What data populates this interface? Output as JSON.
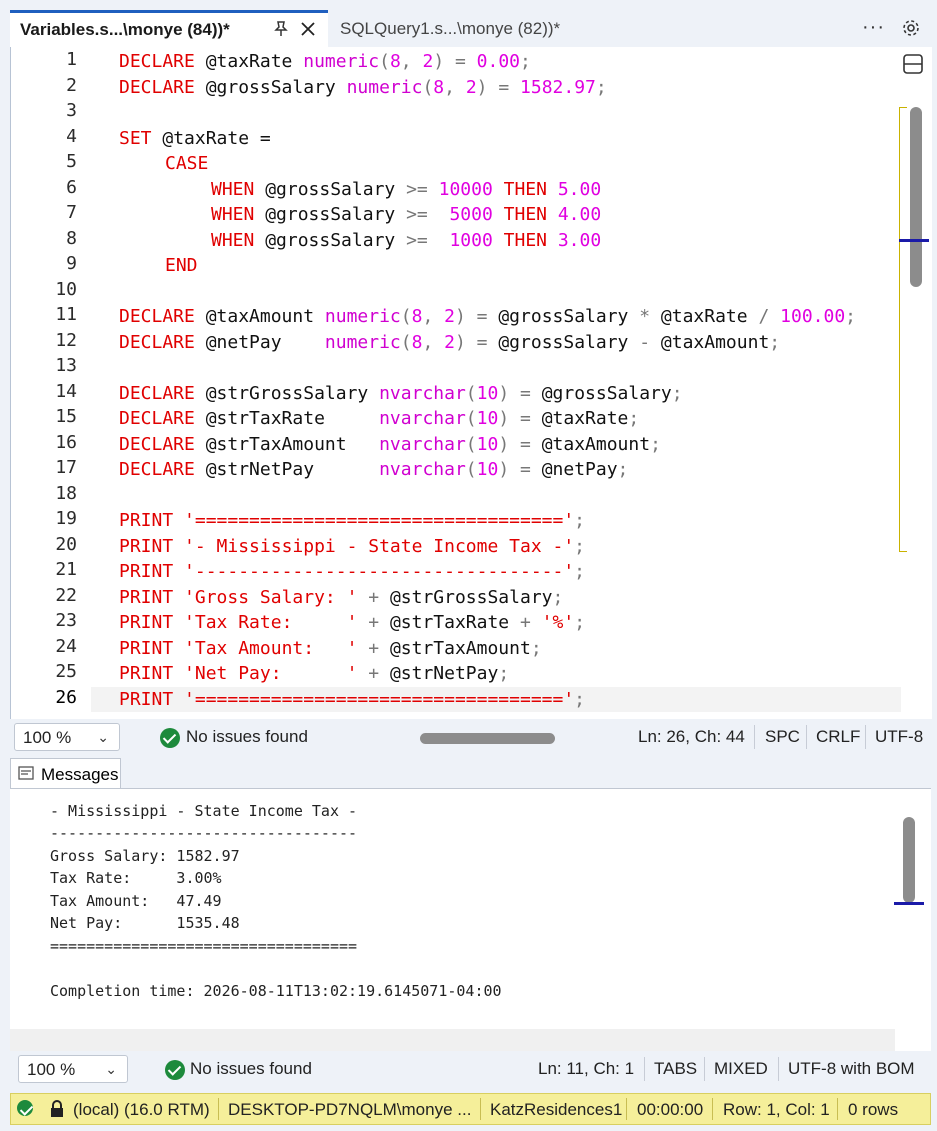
{
  "tabs": [
    {
      "label": "Variables.s...\\monye (84))*",
      "active": true
    },
    {
      "label": "SQLQuery1.s...\\monye (82))*",
      "active": false
    }
  ],
  "tab_actions": {
    "more": "···"
  },
  "editor": {
    "line_numbers": [
      "1",
      "2",
      "3",
      "4",
      "5",
      "6",
      "7",
      "8",
      "9",
      "10",
      "11",
      "12",
      "13",
      "14",
      "15",
      "16",
      "17",
      "18",
      "19",
      "20",
      "21",
      "22",
      "23",
      "24",
      "25",
      "26"
    ],
    "current_line": "26"
  },
  "code": {
    "l1": {
      "kw": "DECLARE",
      "var": " @taxRate ",
      "ty": "numeric",
      "p1": "(",
      "n1": "8",
      "c": ", ",
      "n2": "2",
      "p2": ")",
      "eq": " = ",
      "val": "0.00",
      "sc": ";"
    },
    "l2": {
      "kw": "DECLARE",
      "var": " @grossSalary ",
      "ty": "numeric",
      "p1": "(",
      "n1": "8",
      "c": ", ",
      "n2": "2",
      "p2": ")",
      "eq": " = ",
      "val": "1582.97",
      "sc": ";"
    },
    "l4": {
      "kw": "SET",
      "var": " @taxRate ="
    },
    "l5": {
      "kw": "CASE"
    },
    "l6": {
      "kw": "WHEN",
      "var": " @grossSalary ",
      "op": ">=",
      "pad": " ",
      "num": "10000",
      "then": " THEN ",
      "res": "5.00"
    },
    "l7": {
      "kw": "WHEN",
      "var": " @grossSalary ",
      "op": ">=",
      "pad": "  ",
      "num": "5000",
      "then": " THEN ",
      "res": "4.00"
    },
    "l8": {
      "kw": "WHEN",
      "var": " @grossSalary ",
      "op": ">=",
      "pad": "  ",
      "num": "1000",
      "then": " THEN ",
      "res": "3.00"
    },
    "l9": {
      "kw": "END"
    },
    "l11": {
      "kw": "DECLARE",
      "var": " @taxAmount ",
      "ty": "numeric",
      "p1": "(",
      "n1": "8",
      "c": ", ",
      "n2": "2",
      "p2": ")",
      "eq": " = ",
      "v1": "@grossSalary ",
      "op1": "*",
      "v2": " @taxRate ",
      "op2": "/",
      "sp": " ",
      "val": "100.00",
      "sc": ";"
    },
    "l12": {
      "kw": "DECLARE",
      "var": " @netPay    ",
      "ty": "numeric",
      "p1": "(",
      "n1": "8",
      "c": ", ",
      "n2": "2",
      "p2": ")",
      "eq": " = ",
      "v1": "@grossSalary ",
      "op1": "-",
      "v2": " @taxAmount",
      "sc": ";"
    },
    "l14": {
      "kw": "DECLARE",
      "var": " @strGrossSalary ",
      "ty": "nvarchar",
      "p1": "(",
      "n1": "10",
      "p2": ")",
      "eq": " = ",
      "val": "@grossSalary",
      "sc": ";"
    },
    "l15": {
      "kw": "DECLARE",
      "var": " @strTaxRate     ",
      "ty": "nvarchar",
      "p1": "(",
      "n1": "10",
      "p2": ")",
      "eq": " = ",
      "val": "@taxRate",
      "sc": ";"
    },
    "l16": {
      "kw": "DECLARE",
      "var": " @strTaxAmount   ",
      "ty": "nvarchar",
      "p1": "(",
      "n1": "10",
      "p2": ")",
      "eq": " = ",
      "val": "@taxAmount",
      "sc": ";"
    },
    "l17": {
      "kw": "DECLARE",
      "var": " @strNetPay      ",
      "ty": "nvarchar",
      "p1": "(",
      "n1": "10",
      "p2": ")",
      "eq": " = ",
      "val": "@netPay",
      "sc": ";"
    },
    "l19": {
      "kw": "PRINT",
      "sp": " ",
      "str": "'=================================='",
      "sc": ";"
    },
    "l20": {
      "kw": "PRINT",
      "sp": " ",
      "str": "'- Mississippi - State Income Tax -'",
      "sc": ";"
    },
    "l21": {
      "kw": "PRINT",
      "sp": " ",
      "str": "'----------------------------------'",
      "sc": ";"
    },
    "l22": {
      "kw": "PRINT",
      "sp": " ",
      "str": "'Gross Salary: '",
      "plus": " + ",
      "var": "@strGrossSalary",
      "sc": ";"
    },
    "l23": {
      "kw": "PRINT",
      "sp": " ",
      "str": "'Tax Rate:     '",
      "plus": " + ",
      "var": "@strTaxRate",
      "plus2": " + ",
      "str2": "'%'",
      "sc": ";"
    },
    "l24": {
      "kw": "PRINT",
      "sp": " ",
      "str": "'Tax Amount:   '",
      "plus": " + ",
      "var": "@strTaxAmount",
      "sc": ";"
    },
    "l25": {
      "kw": "PRINT",
      "sp": " ",
      "str": "'Net Pay:      '",
      "plus": " + ",
      "var": "@strNetPay",
      "sc": ";"
    },
    "l26": {
      "kw": "PRINT",
      "sp": " ",
      "str": "'=================================='",
      "sc": ";"
    }
  },
  "editor_status": {
    "zoom": "100 %",
    "issues": "No issues found",
    "position": "Ln: 26, Ch: 44",
    "indent": "SPC",
    "eol": "CRLF",
    "encoding": "UTF-8"
  },
  "messages": {
    "tab_label": "Messages",
    "lines": [
      "- Mississippi - State Income Tax -",
      "----------------------------------",
      "Gross Salary: 1582.97",
      "Tax Rate:     3.00%",
      "Tax Amount:   47.49",
      "Net Pay:      1535.48",
      "==================================",
      "",
      "Completion time: 2026-08-11T13:02:19.6145071-04:00"
    ]
  },
  "messages_status": {
    "zoom": "100 %",
    "issues": "No issues found",
    "position": "Ln: 11, Ch: 1",
    "indent": "TABS",
    "eol": "MIXED",
    "encoding": "UTF-8 with BOM"
  },
  "connection": {
    "server": "(local) (16.0 RTM)",
    "user": "DESKTOP-PD7NQLM\\monye ...",
    "database": "KatzResidences1",
    "elapsed": "00:00:00",
    "rowcol": "Row: 1, Col: 1",
    "rows": "0 rows"
  }
}
